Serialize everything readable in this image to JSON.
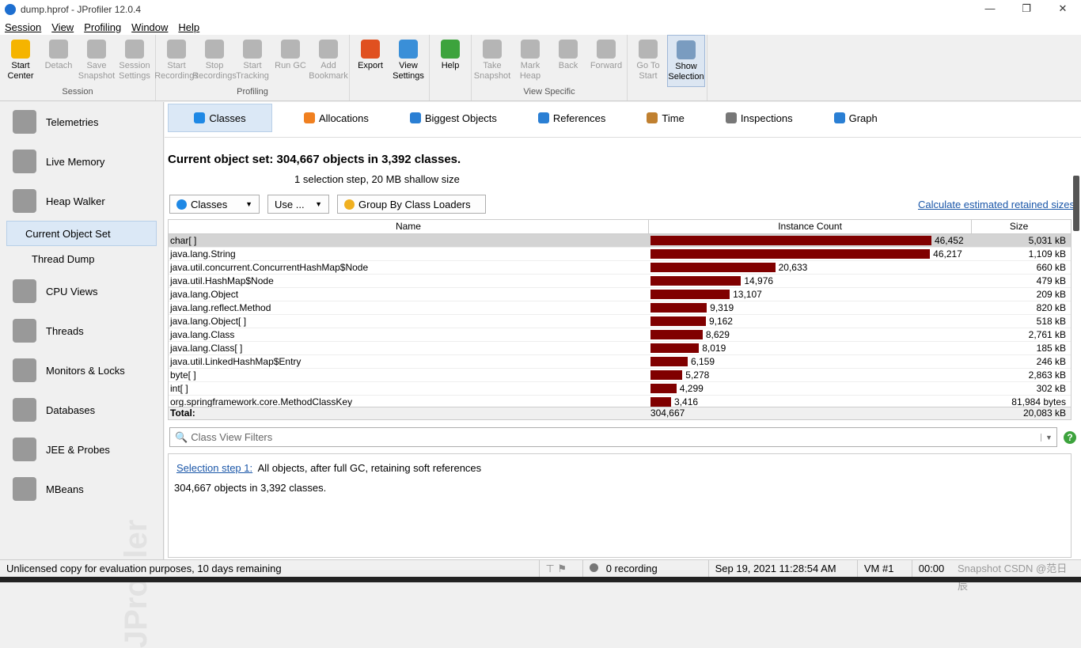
{
  "window": {
    "title": "dump.hprof - JProfiler 12.0.4",
    "controls": [
      "—",
      "❐",
      "✕"
    ]
  },
  "menu": [
    "Session",
    "View",
    "Profiling",
    "Window",
    "Help"
  ],
  "toolbar": {
    "groups": [
      {
        "label": "Session",
        "buttons": [
          {
            "label": "Start Center",
            "enabled": true,
            "color": "#f5b400"
          },
          {
            "label": "Detach",
            "enabled": false
          },
          {
            "label": "Save Snapshot",
            "enabled": false
          },
          {
            "label": "Session Settings",
            "enabled": false
          }
        ]
      },
      {
        "label": "Profiling",
        "buttons": [
          {
            "label": "Start Recordings",
            "enabled": false
          },
          {
            "label": "Stop Recordings",
            "enabled": false
          },
          {
            "label": "Start Tracking",
            "enabled": false
          },
          {
            "label": "Run GC",
            "enabled": false
          },
          {
            "label": "Add Bookmark",
            "enabled": false
          }
        ]
      },
      {
        "label": "",
        "buttons": [
          {
            "label": "Export",
            "enabled": true,
            "color": "#e05020"
          },
          {
            "label": "View Settings",
            "enabled": true,
            "color": "#3a8fd8"
          }
        ]
      },
      {
        "label": "",
        "buttons": [
          {
            "label": "Help",
            "enabled": true,
            "color": "#3da33d"
          }
        ]
      },
      {
        "label": "View Specific",
        "buttons": [
          {
            "label": "Take Snapshot",
            "enabled": false
          },
          {
            "label": "Mark Heap",
            "enabled": false
          },
          {
            "label": "Back",
            "enabled": false
          },
          {
            "label": "Forward",
            "enabled": false
          }
        ]
      },
      {
        "label": "",
        "buttons": [
          {
            "label": "Go To Start",
            "enabled": false
          },
          {
            "label": "Show Selection",
            "enabled": true,
            "selected": true,
            "color": "#7a9cc0"
          }
        ]
      }
    ]
  },
  "sidebar": {
    "items": [
      {
        "label": "Telemetries",
        "type": "main"
      },
      {
        "label": "Live Memory",
        "type": "main"
      },
      {
        "label": "Heap Walker",
        "type": "main"
      },
      {
        "label": "Current Object Set",
        "type": "sub",
        "selected": true
      },
      {
        "label": "Thread Dump",
        "type": "sub"
      },
      {
        "label": "CPU Views",
        "type": "main"
      },
      {
        "label": "Threads",
        "type": "main"
      },
      {
        "label": "Monitors & Locks",
        "type": "main"
      },
      {
        "label": "Databases",
        "type": "main"
      },
      {
        "label": "JEE & Probes",
        "type": "main"
      },
      {
        "label": "MBeans",
        "type": "main"
      }
    ],
    "watermark": "JProfiler"
  },
  "tabs": [
    {
      "label": "Classes",
      "selected": true,
      "color": "#1e88e5"
    },
    {
      "label": "Allocations",
      "color": "#f08020"
    },
    {
      "label": "Biggest Objects",
      "color": "#2a7fd4"
    },
    {
      "label": "References",
      "color": "#2a7fd4"
    },
    {
      "label": "Time",
      "color": "#c08030"
    },
    {
      "label": "Inspections",
      "color": "#777"
    },
    {
      "label": "Graph",
      "color": "#2a7fd4"
    }
  ],
  "header": {
    "title": "Current object set:  304,667 objects in 3,392 classes.",
    "subtitle": "1 selection step, 20 MB shallow size"
  },
  "controls": {
    "view": "Classes",
    "use": "Use ...",
    "group": "Group By Class Loaders",
    "calculate": "Calculate estimated retained sizes"
  },
  "table": {
    "columns": [
      "Name",
      "Instance Count",
      "Size"
    ],
    "max_count": 46452,
    "rows": [
      {
        "name": "char[ ]",
        "count": 46452,
        "count_label": "46,452",
        "size": "5,031 kB"
      },
      {
        "name": "java.lang.String",
        "count": 46217,
        "count_label": "46,217",
        "size": "1,109 kB"
      },
      {
        "name": "java.util.concurrent.ConcurrentHashMap$Node",
        "count": 20633,
        "count_label": "20,633",
        "size": "660 kB"
      },
      {
        "name": "java.util.HashMap$Node",
        "count": 14976,
        "count_label": "14,976",
        "size": "479 kB"
      },
      {
        "name": "java.lang.Object",
        "count": 13107,
        "count_label": "13,107",
        "size": "209 kB"
      },
      {
        "name": "java.lang.reflect.Method",
        "count": 9319,
        "count_label": "9,319",
        "size": "820 kB"
      },
      {
        "name": "java.lang.Object[ ]",
        "count": 9162,
        "count_label": "9,162",
        "size": "518 kB"
      },
      {
        "name": "java.lang.Class",
        "count": 8629,
        "count_label": "8,629",
        "size": "2,761 kB"
      },
      {
        "name": "java.lang.Class[ ]",
        "count": 8019,
        "count_label": "8,019",
        "size": "185 kB"
      },
      {
        "name": "java.util.LinkedHashMap$Entry",
        "count": 6159,
        "count_label": "6,159",
        "size": "246 kB"
      },
      {
        "name": "byte[ ]",
        "count": 5278,
        "count_label": "5,278",
        "size": "2,863 kB"
      },
      {
        "name": "int[ ]",
        "count": 4299,
        "count_label": "4,299",
        "size": "302 kB"
      },
      {
        "name": "org.springframework.core.MethodClassKey",
        "count": 3416,
        "count_label": "3,416",
        "size": "81,984 bytes"
      }
    ],
    "total": {
      "label": "Total:",
      "count": "304,667",
      "size": "20,083 kB"
    }
  },
  "filter": {
    "placeholder": "Class View Filters"
  },
  "info": {
    "link": "Selection step 1:",
    "text": "All objects, after full GC, retaining soft references",
    "summary": "304,667 objects in 3,392 classes."
  },
  "status": {
    "license": "Unlicensed copy for evaluation purposes, 10 days remaining",
    "recording": "0 recording",
    "datetime": "Sep 19, 2021 11:28:54 AM",
    "vm": "VM #1",
    "time": "00:00",
    "mode": "Snapshot",
    "overlay": "CSDN @范日辰"
  }
}
